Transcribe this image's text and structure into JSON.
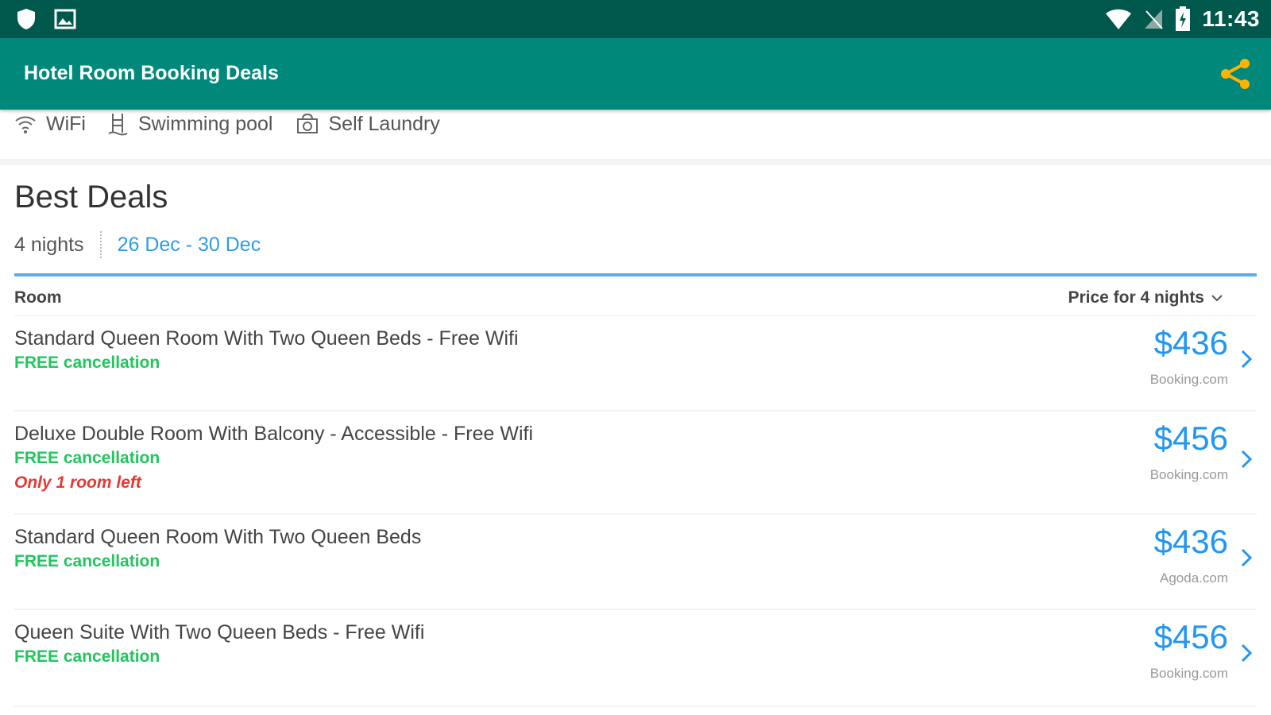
{
  "status_bar": {
    "time": "11:43",
    "left_icons": [
      "shield-icon",
      "image-icon"
    ],
    "right_icons": [
      "wifi-icon",
      "no-signal-icon",
      "battery-icon"
    ]
  },
  "app_bar": {
    "title": "Hotel Room Booking Deals",
    "share_icon": "share-icon",
    "accent_color": "#00897b",
    "share_color": "#ffb300"
  },
  "amenities": [
    {
      "label": "WiFi",
      "icon": "wifi-icon"
    },
    {
      "label": "Swimming pool",
      "icon": "pool-ladder-icon"
    },
    {
      "label": "Self Laundry",
      "icon": "laundry-icon"
    }
  ],
  "best_deals": {
    "title": "Best Deals",
    "nights": "4 nights",
    "dates": "26 Dec - 30 Dec"
  },
  "table": {
    "room_header": "Room",
    "price_header": "Price for 4 nights"
  },
  "rooms": [
    {
      "name": "Standard Queen Room With Two Queen Beds - Free Wifi",
      "cancellation": "FREE cancellation",
      "availability": "",
      "price": "$436",
      "provider": "Booking.com"
    },
    {
      "name": "Deluxe Double Room With Balcony - Accessible - Free Wifi",
      "cancellation": "FREE cancellation",
      "availability": "Only 1 room left",
      "price": "$456",
      "provider": "Booking.com"
    },
    {
      "name": "Standard Queen Room With Two Queen Beds",
      "cancellation": "FREE cancellation",
      "availability": "",
      "price": "$436",
      "provider": "Agoda.com"
    },
    {
      "name": "Queen Suite With Two Queen Beds - Free Wifi",
      "cancellation": "FREE cancellation",
      "availability": "",
      "price": "$456",
      "provider": "Booking.com"
    }
  ],
  "colors": {
    "status_bar": "#00574b",
    "price_blue": "#2196f3",
    "free_green": "#22c55e",
    "alert_red": "#e53935"
  }
}
